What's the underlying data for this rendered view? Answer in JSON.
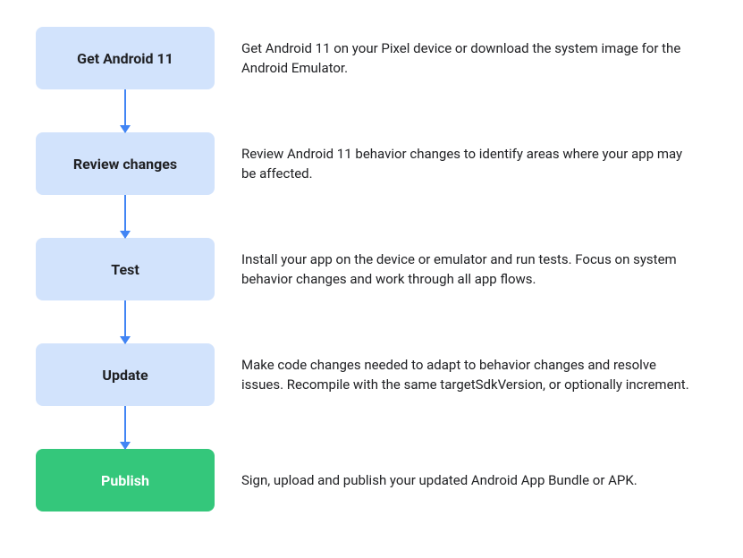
{
  "steps": [
    {
      "label": "Get Android 11",
      "description": "Get Android 11 on your Pixel device or download the system image for the Android Emulator.",
      "color": "blue"
    },
    {
      "label": "Review changes",
      "description": "Review Android 11 behavior changes to identify areas where your app may be affected.",
      "color": "blue"
    },
    {
      "label": "Test",
      "description": "Install your app on the device or emulator and run tests. Focus on system behavior changes and work through all app flows.",
      "color": "blue"
    },
    {
      "label": "Update",
      "description": "Make code changes needed to adapt to behavior changes and resolve issues. Recompile with the same targetSdkVersion, or optionally increment.",
      "color": "blue"
    },
    {
      "label": "Publish",
      "description": "Sign, upload and publish your updated Android App Bundle or APK.",
      "color": "green"
    }
  ]
}
